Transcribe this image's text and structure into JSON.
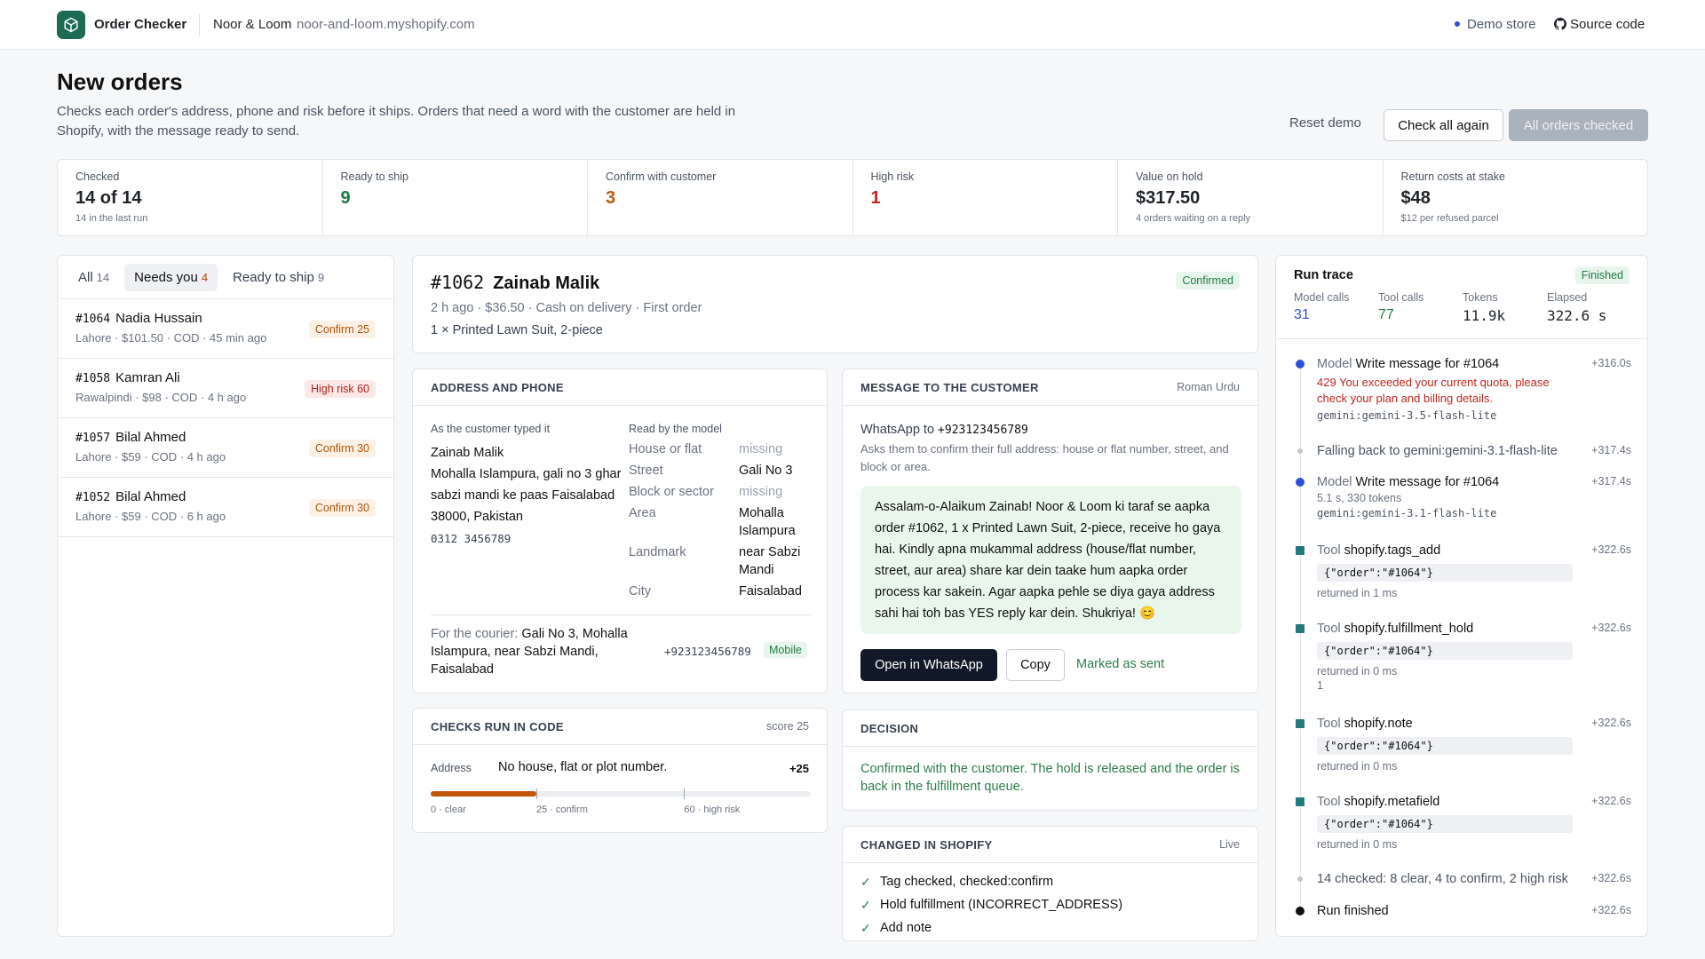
{
  "app": {
    "name": "Order Checker",
    "store_name": "Noor & Loom",
    "store_domain": "noor-and-loom.myshopify.com",
    "demo_label": "Demo store",
    "source_label": "Source code"
  },
  "page": {
    "title": "New orders",
    "subtitle": "Checks each order's address, phone and risk before it ships. Orders that need a word with the customer are held in Shopify, with the message ready to send.",
    "reset_label": "Reset demo",
    "check_label": "Check all again",
    "done_label": "All orders checked"
  },
  "stats": [
    {
      "label": "Checked",
      "value": "14 of 14",
      "note": "14 in the last run",
      "color": "#1f2328"
    },
    {
      "label": "Ready to ship",
      "value": "9",
      "note": "",
      "color": "#237a45"
    },
    {
      "label": "Confirm with customer",
      "value": "3",
      "note": "",
      "color": "#c2560b"
    },
    {
      "label": "High risk",
      "value": "1",
      "note": "",
      "color": "#c0271e"
    },
    {
      "label": "Value on hold",
      "value": "$317.50",
      "note": "4 orders waiting on a reply",
      "color": "#1f2328"
    },
    {
      "label": "Return costs at stake",
      "value": "$48",
      "note": "$12 per refused parcel",
      "color": "#1f2328"
    }
  ],
  "tabs": [
    {
      "label": "All",
      "count": "14"
    },
    {
      "label": "Needs you",
      "count": "4"
    },
    {
      "label": "Ready to ship",
      "count": "9"
    }
  ],
  "orders": [
    {
      "id": "#1064",
      "name": "Nadia Hussain",
      "meta": "Lahore · $101.50 · COD · 45 min ago",
      "badge": "Confirm 25"
    },
    {
      "id": "#1058",
      "name": "Kamran Ali",
      "meta": "Rawalpindi · $98 · COD · 4 h ago",
      "badge": "High risk 60"
    },
    {
      "id": "#1057",
      "name": "Bilal Ahmed",
      "meta": "Lahore · $59 · COD · 4 h ago",
      "badge": "Confirm 30"
    },
    {
      "id": "#1052",
      "name": "Bilal Ahmed",
      "meta": "Lahore · $59 · COD · 6 h ago",
      "badge": "Confirm 30"
    }
  ],
  "detail": {
    "id": "#1062",
    "name": "Zainab Malik",
    "meta": "2 h ago · $36.50 · Cash on delivery · First order",
    "items": "1 × Printed Lawn Suit, 2-piece",
    "status": "Confirmed"
  },
  "address": {
    "heading": "ADDRESS AND PHONE",
    "typed_label": "As the customer typed it",
    "model_label": "Read by the model",
    "typed_name": "Zainab Malik",
    "typed_address": "Mohalla Islampura, gali no 3 ghar sabzi mandi ke paas Faisalabad 38000, Pakistan",
    "typed_phone": "0312 3456789",
    "fields": [
      {
        "key": "House or flat",
        "value": "missing"
      },
      {
        "key": "Street",
        "value": "Gali No 3"
      },
      {
        "key": "Block or sector",
        "value": "missing"
      },
      {
        "key": "Area",
        "value": "Mohalla Islampura"
      },
      {
        "key": "Landmark",
        "value": "near Sabzi Mandi"
      },
      {
        "key": "City",
        "value": "Faisalabad"
      }
    ],
    "courier_label": "For the courier:",
    "courier_value": "Gali No 3, Mohalla Islampura, near Sabzi Mandi, Faisalabad",
    "courier_phone": "+923123456789",
    "phone_type": "Mobile"
  },
  "message": {
    "heading": "MESSAGE TO THE CUSTOMER",
    "language": "Roman Urdu",
    "to_label": "WhatsApp to",
    "to_number": "+923123456789",
    "description": "Asks them to confirm their full address: house or flat number, street, and block or area.",
    "text": "Assalam-o-Alaikum Zainab! Noor & Loom ki taraf se aapka order #1062, 1 x Printed Lawn Suit, 2-piece, receive ho gaya hai. Kindly apna mukammal address (house/flat number, street, aur area) share kar dein taake hum aapka order process kar sakein. Agar aapka pehle se diya gaya address sahi hai toh bas YES reply kar dein. Shukriya! 😊",
    "whatsapp_label": "Open in WhatsApp",
    "copy_label": "Copy",
    "sent_label": "Marked as sent"
  },
  "checks": {
    "heading": "CHECKS RUN IN CODE",
    "score_label": "score 25",
    "row_label": "Address",
    "row_text": "No house, flat or plot number.",
    "row_points": "+25",
    "score": 25,
    "scale_max": 90,
    "ticks": [
      {
        "value": 0,
        "label": "0 · clear"
      },
      {
        "value": 25,
        "label": "25 · confirm"
      },
      {
        "value": 60,
        "label": "60 · high risk"
      }
    ]
  },
  "decision": {
    "heading": "DECISION",
    "text": "Confirmed with the customer. The hold is released and the order is back in the fulfillment queue."
  },
  "changed": {
    "heading": "CHANGED IN SHOPIFY",
    "badge": "Live",
    "items": [
      "Tag checked, checked:confirm",
      "Hold fulfillment (INCORRECT_ADDRESS)",
      "Add note"
    ]
  },
  "trace": {
    "title": "Run trace",
    "status": "Finished",
    "stats": [
      {
        "label": "Model calls",
        "value": "31"
      },
      {
        "label": "Tool calls",
        "value": "77"
      },
      {
        "label": "Tokens",
        "value": "11.9k"
      },
      {
        "label": "Elapsed",
        "value": "322.6 s"
      }
    ],
    "events": [
      {
        "kind": "Model",
        "title": "Write message for #1064",
        "time": "+316.0s",
        "error": "429 You exceeded your current quota, please check your plan and billing details.",
        "model": "gemini:gemini-3.5-flash-lite"
      },
      {
        "title": "Falling back to gemini:gemini-3.1-flash-lite",
        "time": "+317.4s"
      },
      {
        "kind": "Model",
        "title": "Write message for #1064",
        "time": "+317.4s",
        "detail": "5.1 s, 330 tokens",
        "model": "gemini:gemini-3.1-flash-lite"
      },
      {
        "kind": "Tool",
        "title": "shopify.tags_add",
        "time": "+322.6s",
        "code": "{\"order\":\"#1064\"}",
        "returned": "returned in 1 ms"
      },
      {
        "kind": "Tool",
        "title": "shopify.fulfillment_hold",
        "time": "+322.6s",
        "code": "{\"order\":\"#1064\"}",
        "returned": "returned in 0 ms",
        "extra": "1"
      },
      {
        "kind": "Tool",
        "title": "shopify.note",
        "time": "+322.6s",
        "code": "{\"order\":\"#1064\"}",
        "returned": "returned in 0 ms"
      },
      {
        "kind": "Tool",
        "title": "shopify.metafield",
        "time": "+322.6s",
        "code": "{\"order\":\"#1064\"}",
        "returned": "returned in 0 ms"
      },
      {
        "title": "14 checked: 8 clear, 4 to confirm, 2 high risk",
        "time": "+322.6s"
      },
      {
        "title": "Run finished",
        "time": "+322.6s"
      }
    ]
  }
}
